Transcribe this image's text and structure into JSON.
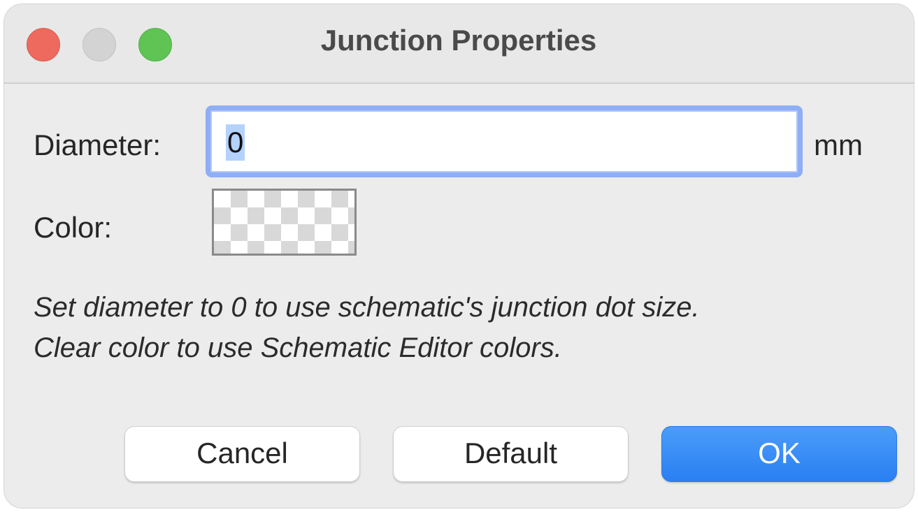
{
  "window": {
    "title": "Junction Properties"
  },
  "form": {
    "diameter_label": "Diameter:",
    "diameter_value": "0",
    "diameter_unit": "mm",
    "color_label": "Color:",
    "color_value": "transparent"
  },
  "hints": {
    "line1": "Set diameter to 0 to use schematic's junction dot size.",
    "line2": "Clear color to use Schematic Editor colors."
  },
  "buttons": {
    "cancel": "Cancel",
    "default": "Default",
    "ok": "OK"
  },
  "colors": {
    "accent": "#2a7ff2",
    "close": "#ee6a5e",
    "minimize": "#d3d3d3",
    "maximize": "#5fc454",
    "focus_ring": "#8eaef5"
  }
}
